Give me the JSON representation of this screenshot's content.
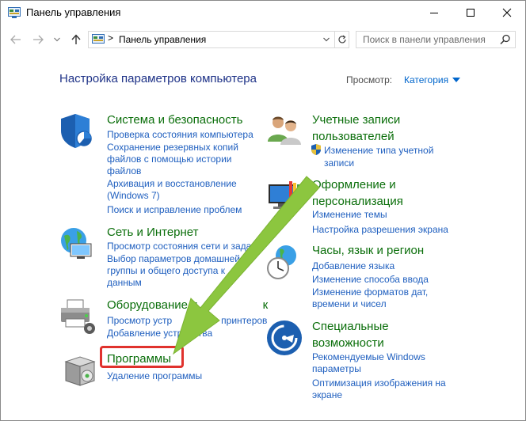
{
  "window": {
    "title": "Панель управления"
  },
  "address_bar": {
    "separator": ">",
    "path": "Панель управления",
    "search_placeholder": "Поиск в панели управления"
  },
  "header": {
    "title": "Настройка параметров компьютера",
    "view_label": "Просмотр:",
    "view_value": "Категория"
  },
  "categories": {
    "system": {
      "title": "Система и безопасность",
      "links": [
        "Проверка состояния компьютера",
        "Сохранение резервных копий",
        "файлов с помощью истории",
        "файлов",
        "Архивация и восстановление",
        "(Windows 7)",
        "Поиск и исправление проблем"
      ]
    },
    "network": {
      "title": "Сеть и Интернет",
      "links": [
        "Просмотр состояния сети и задач",
        "Выбор параметров домашней",
        "группы и общего доступа к",
        "данным"
      ]
    },
    "hardware": {
      "title": "Оборудование и звук",
      "title_visible": "Оборудование и",
      "title_tail": "к",
      "links": [
        "Просмотр устр",
        "принтеров",
        "Добавление устройства"
      ]
    },
    "programs": {
      "title": "Программы",
      "links": [
        "Удаление программы"
      ]
    },
    "accounts": {
      "title_lines": [
        "Учетные записи",
        "пользователей"
      ],
      "links": [
        "Изменение типа учетной",
        "записи"
      ]
    },
    "appearance": {
      "title_lines": [
        "Оформление и",
        "персонализация"
      ],
      "links": [
        "Изменение темы",
        "Настройка разрешения экрана"
      ]
    },
    "clock": {
      "title": "Часы, язык и регион",
      "links": [
        "Добавление языка",
        "Изменение способа ввода",
        "Изменение форматов дат,",
        "времени и чисел"
      ]
    },
    "access": {
      "title_lines": [
        "Специальные",
        "возможности"
      ],
      "links": [
        "Рекомендуемые Windows",
        "параметры",
        "Оптимизация изображения на",
        "экране"
      ]
    }
  },
  "colors": {
    "category_title": "#0a6e0a",
    "link": "#1f5fbf",
    "heading": "#1e3287",
    "highlight": "#e0322d",
    "arrow": "#8cc63f"
  }
}
